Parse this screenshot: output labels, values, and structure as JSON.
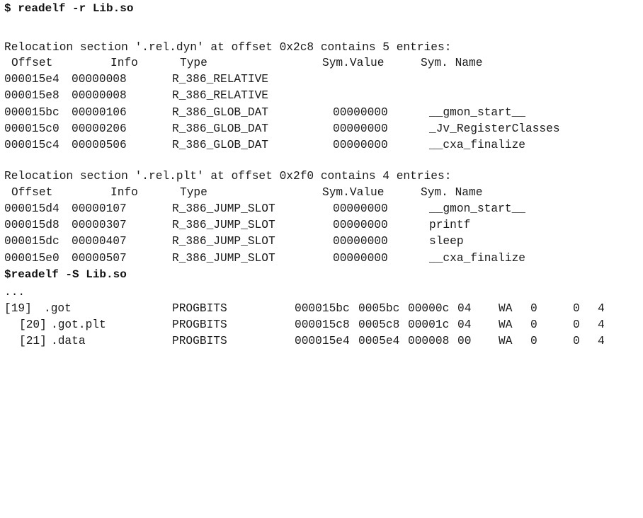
{
  "cmd1": "$ readelf -r Lib.so",
  "dyn": {
    "header": "Relocation section '.rel.dyn' at offset 0x2c8 contains 5 entries:",
    "cols": [
      "Offset",
      "Info",
      "Type",
      "Sym.Value",
      "Sym. Name"
    ],
    "rows": [
      [
        "000015e4",
        "00000008",
        "R_386_RELATIVE",
        "",
        ""
      ],
      [
        "000015e8",
        "00000008",
        "R_386_RELATIVE",
        "",
        ""
      ],
      [
        "000015bc",
        "00000106",
        "R_386_GLOB_DAT",
        "00000000",
        "__gmon_start__"
      ],
      [
        "000015c0",
        "00000206",
        "R_386_GLOB_DAT",
        "00000000",
        "_Jv_RegisterClasses"
      ],
      [
        "000015c4",
        "00000506",
        "R_386_GLOB_DAT",
        "00000000",
        "__cxa_finalize"
      ]
    ]
  },
  "plt": {
    "header": "Relocation section '.rel.plt' at offset 0x2f0 contains 4 entries:",
    "cols": [
      "Offset",
      "Info",
      "Type",
      "Sym.Value",
      "Sym. Name"
    ],
    "rows": [
      [
        "000015d4",
        "00000107",
        "R_386_JUMP_SLOT",
        "00000000",
        "__gmon_start__"
      ],
      [
        "000015d8",
        "00000307",
        "R_386_JUMP_SLOT",
        "00000000",
        "printf"
      ],
      [
        "000015dc",
        "00000407",
        "R_386_JUMP_SLOT",
        "00000000",
        "sleep"
      ],
      [
        "000015e0",
        "00000507",
        "R_386_JUMP_SLOT",
        "00000000",
        "__cxa_finalize"
      ]
    ]
  },
  "cmd2": "$readelf -S Lib.so",
  "ellipsis": "...",
  "sections": [
    [
      "[19]",
      ".got",
      "PROGBITS",
      "000015bc",
      "0005bc",
      "00000c",
      "04",
      "WA",
      "0",
      "0",
      "4"
    ],
    [
      "[20]",
      ".got.plt",
      "PROGBITS",
      "000015c8",
      "0005c8",
      "00001c",
      "04",
      "WA",
      "0",
      "0",
      "4"
    ],
    [
      "[21]",
      ".data",
      "PROGBITS",
      "000015e4",
      "0005e4",
      "000008",
      "00",
      "WA",
      "0",
      "0",
      "4"
    ]
  ]
}
